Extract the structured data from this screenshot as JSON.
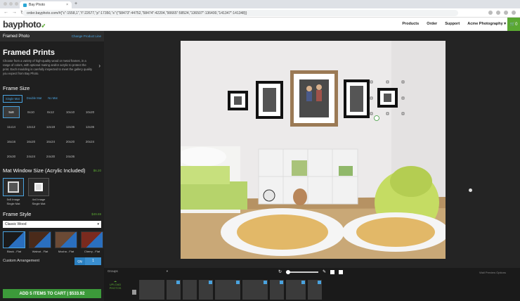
{
  "browser": {
    "tab_title": "Bay Photo",
    "url": "order.bayphoto.com/#{\"c\":1558,1\",\"t\":22677,\"p\":17350,\"s\":{\"58473\":44752,\"58474\":42204,\"90665\":58524,\"136507\":136400,\"141347\":141348}}"
  },
  "site": {
    "logo": "bayphoto",
    "nav": [
      "Products",
      "Order",
      "Support",
      "Acme Photography ▾"
    ],
    "cart_count": "0"
  },
  "sidebar": {
    "header_title": "Framed Photo",
    "change_link": "Change Product Line",
    "product_title": "Framed Prints",
    "description": "Choose from a variety of high-quality wood or metal frames, in a range of colors, with optional mating and/or acrylic to protect the print. Each moulding is carefully inspected to meet the gallery quality you expect from Bay Photo.",
    "frame_size_title": "Frame Size",
    "mat_tabs": [
      "Single Mat",
      "Double Mat",
      "No Mat"
    ],
    "sizes": [
      "5x8",
      "8x10",
      "8x12",
      "10x10",
      "10x20",
      "11x14",
      "12x12",
      "12x18",
      "12x36",
      "12x36",
      "16x16",
      "16x20",
      "16x24",
      "20x20",
      "20x24",
      "20x30",
      "24x24",
      "24x30",
      "24x36"
    ],
    "mat_window_title": "Mat Window Size (Acrylic Included)",
    "mat_window_price": "$6.20",
    "mat_options": [
      {
        "line1": "5x5 Image",
        "line2": "Single Mat"
      },
      {
        "line1": "4x4 Image",
        "line2": "Single Mat"
      }
    ],
    "frame_style_title": "Frame Style",
    "frame_style_price": "$49.69",
    "frame_style_value": "Classic Wood",
    "swatches": [
      {
        "label": "Black - Flat",
        "color": "#1a1a1a"
      },
      {
        "label": "Walnut - Flat",
        "color": "#4a2a1a"
      },
      {
        "label": "Mocha - Flat",
        "color": "#6b4a35"
      },
      {
        "label": "Cherry - Flat",
        "color": "#7a2a1e"
      }
    ],
    "custom_label": "Custom Arrangement",
    "qty_label": "Qty",
    "qty_value": "1",
    "add_to_cart": "ADD 5 ITEMS TO CART | $533.92"
  },
  "bottom": {
    "groups_label": "Groups",
    "upload_label": "UPLOAD PHOTOS",
    "wall_preview": "Wall Preview Options"
  },
  "colors": {
    "accent_blue": "#4aa3df",
    "accent_green": "#5aa832",
    "sidebar_bg": "#1f1f1f"
  }
}
